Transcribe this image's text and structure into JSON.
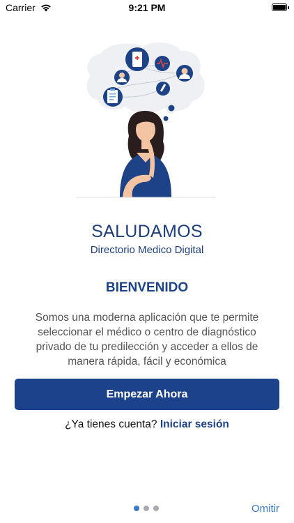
{
  "status_bar": {
    "carrier": "Carrier",
    "time": "9:21 PM"
  },
  "main": {
    "title": "SALUDAMOS",
    "subtitle": "Directorio Medico Digital",
    "welcome": "BIENVENIDO",
    "description": "Somos una moderna aplicación que te permite seleccionar el médico o centro de diagnóstico privado de tu predilección y acceder a ellos de manera rápida, fácil y económica",
    "start_button": "Empezar Ahora",
    "login_prompt": "¿Ya tienes cuenta?",
    "login_link": "Iniciar sesión"
  },
  "footer": {
    "skip": "Omitir",
    "pages": 3,
    "current_page": 1
  },
  "colors": {
    "primary": "#1b428a",
    "link": "#3a7bc8"
  }
}
